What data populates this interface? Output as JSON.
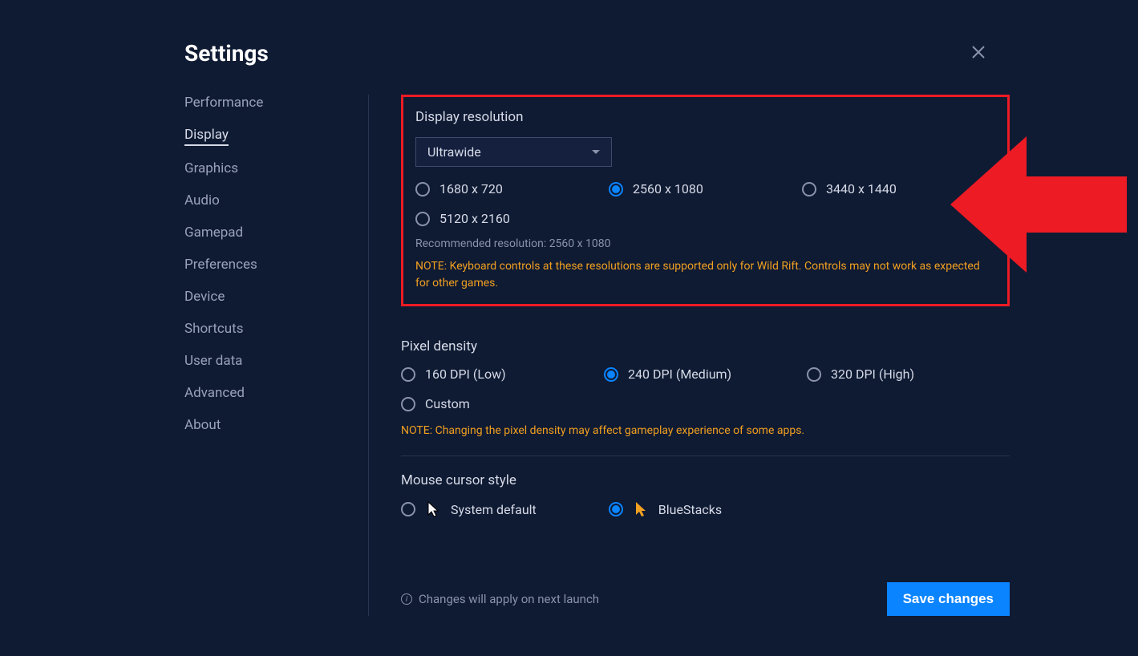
{
  "title": "Settings",
  "sidebar": {
    "items": [
      {
        "label": "Performance",
        "active": false
      },
      {
        "label": "Display",
        "active": true
      },
      {
        "label": "Graphics",
        "active": false
      },
      {
        "label": "Audio",
        "active": false
      },
      {
        "label": "Gamepad",
        "active": false
      },
      {
        "label": "Preferences",
        "active": false
      },
      {
        "label": "Device",
        "active": false
      },
      {
        "label": "Shortcuts",
        "active": false
      },
      {
        "label": "User data",
        "active": false
      },
      {
        "label": "Advanced",
        "active": false
      },
      {
        "label": "About",
        "active": false
      }
    ]
  },
  "display_resolution": {
    "label": "Display resolution",
    "dropdown_value": "Ultrawide",
    "options": [
      {
        "label": "1680 x 720",
        "selected": false
      },
      {
        "label": "2560 x 1080",
        "selected": true
      },
      {
        "label": "3440 x 1440",
        "selected": false
      },
      {
        "label": "5120 x 2160",
        "selected": false
      }
    ],
    "recommended": "Recommended resolution: 2560 x 1080",
    "note": "NOTE: Keyboard controls at these resolutions are supported only for Wild Rift. Controls may not work as expected for other games."
  },
  "pixel_density": {
    "label": "Pixel density",
    "options": [
      {
        "label": "160 DPI (Low)",
        "selected": false
      },
      {
        "label": "240 DPI (Medium)",
        "selected": true
      },
      {
        "label": "320 DPI (High)",
        "selected": false
      },
      {
        "label": "Custom",
        "selected": false
      }
    ],
    "note": "NOTE: Changing the pixel density may affect gameplay experience of some apps."
  },
  "cursor_style": {
    "label": "Mouse cursor style",
    "options": [
      {
        "label": "System default",
        "selected": false
      },
      {
        "label": "BlueStacks",
        "selected": true
      }
    ]
  },
  "footer": {
    "info": "Changes will apply on next launch",
    "save": "Save changes"
  }
}
